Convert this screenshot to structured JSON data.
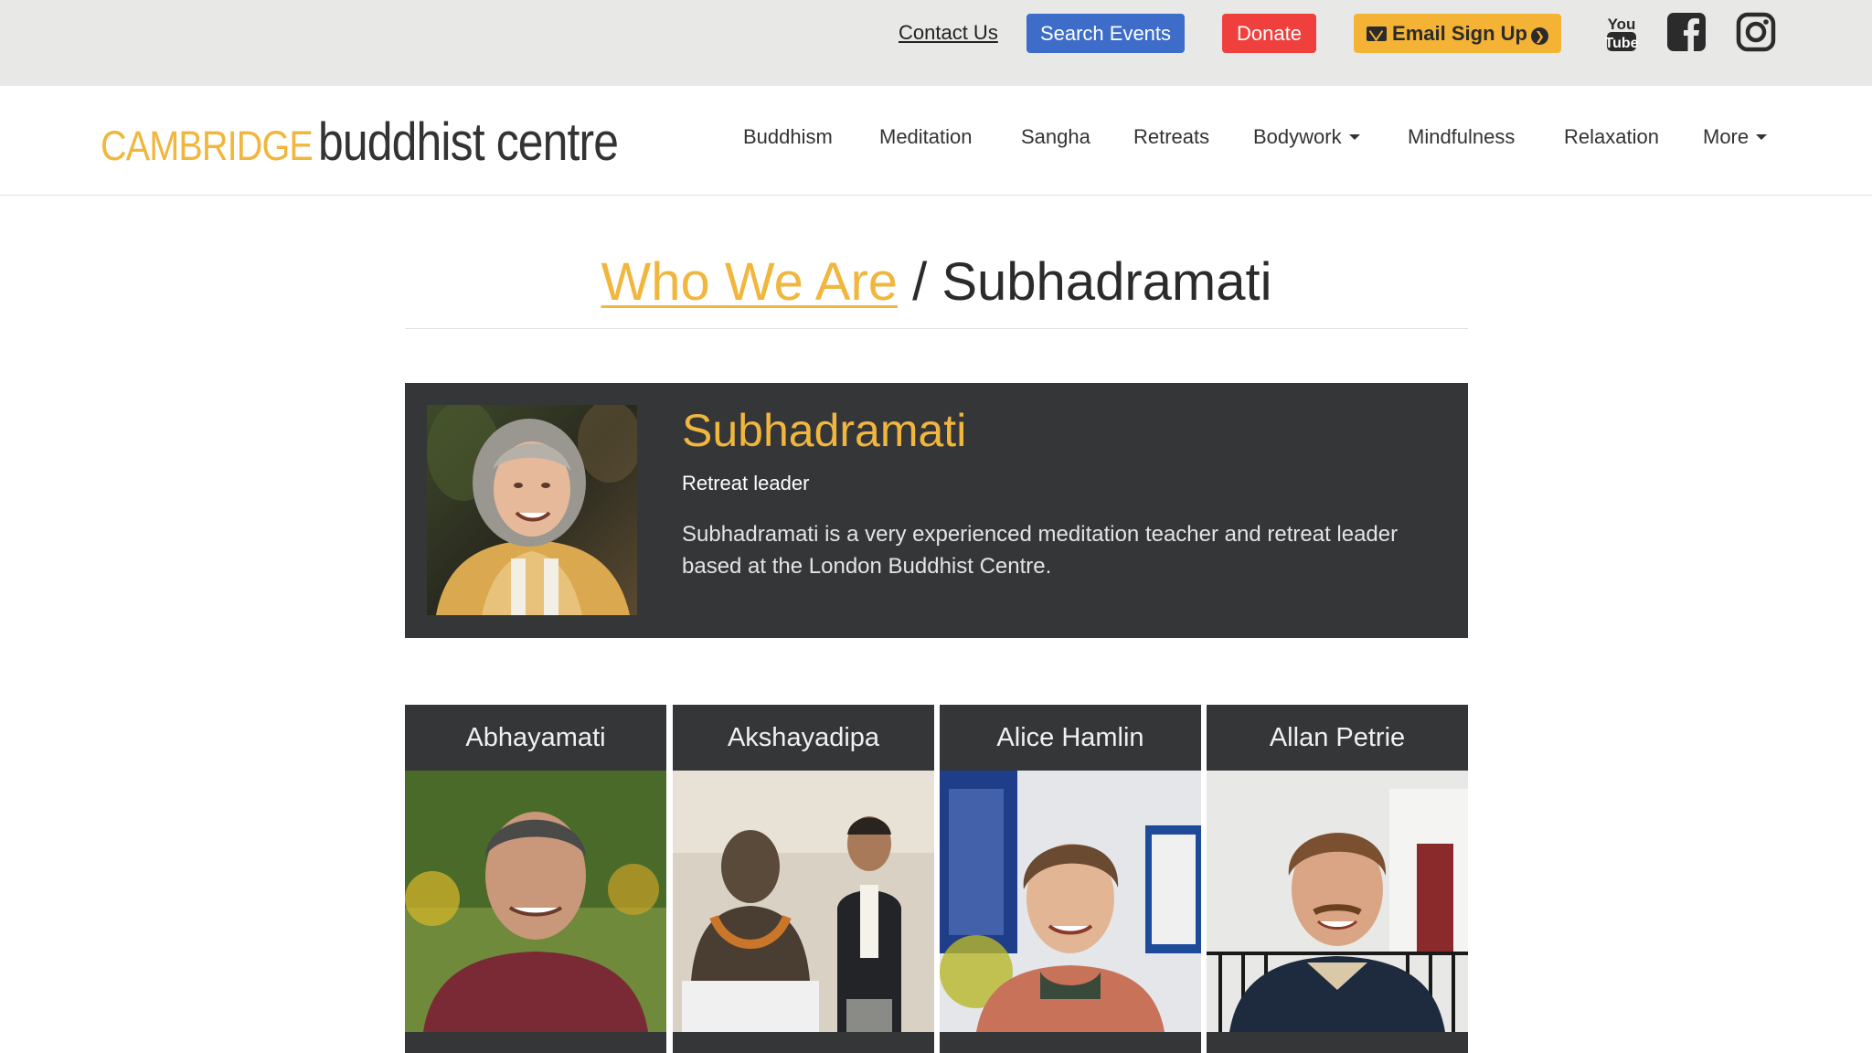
{
  "topbar": {
    "contact_label": "Contact Us",
    "search_label": "Search Events",
    "donate_label": "Donate",
    "email_label": "Email Sign Up",
    "social": [
      "youtube-icon",
      "facebook-icon",
      "instagram-icon"
    ],
    "youtube_you": "You",
    "youtube_tube": "Tube",
    "colors": {
      "search": "#3d6cc9",
      "donate": "#f0403e",
      "email": "#f5b335"
    }
  },
  "logo": {
    "part1": "CAMBRIDGE",
    "part2": "buddhist centre"
  },
  "nav": {
    "items": [
      "Buddhism",
      "Meditation",
      "Sangha",
      "Retreats",
      "Bodywork",
      "Mindfulness",
      "Relaxation",
      "More"
    ]
  },
  "heading": {
    "crumb": "Who We Are",
    "separator": " / ",
    "current": "Subhadramati"
  },
  "profile": {
    "name": "Subhadramati",
    "role": "Retreat leader",
    "bio": "Subhadramati is a very experienced meditation teacher and retreat leader based at the London Buddhist Centre."
  },
  "members": [
    {
      "name": "Abhayamati"
    },
    {
      "name": "Akshayadipa"
    },
    {
      "name": "Alice Hamlin"
    },
    {
      "name": "Allan Petrie"
    }
  ],
  "accent_color": "#f1b63d"
}
